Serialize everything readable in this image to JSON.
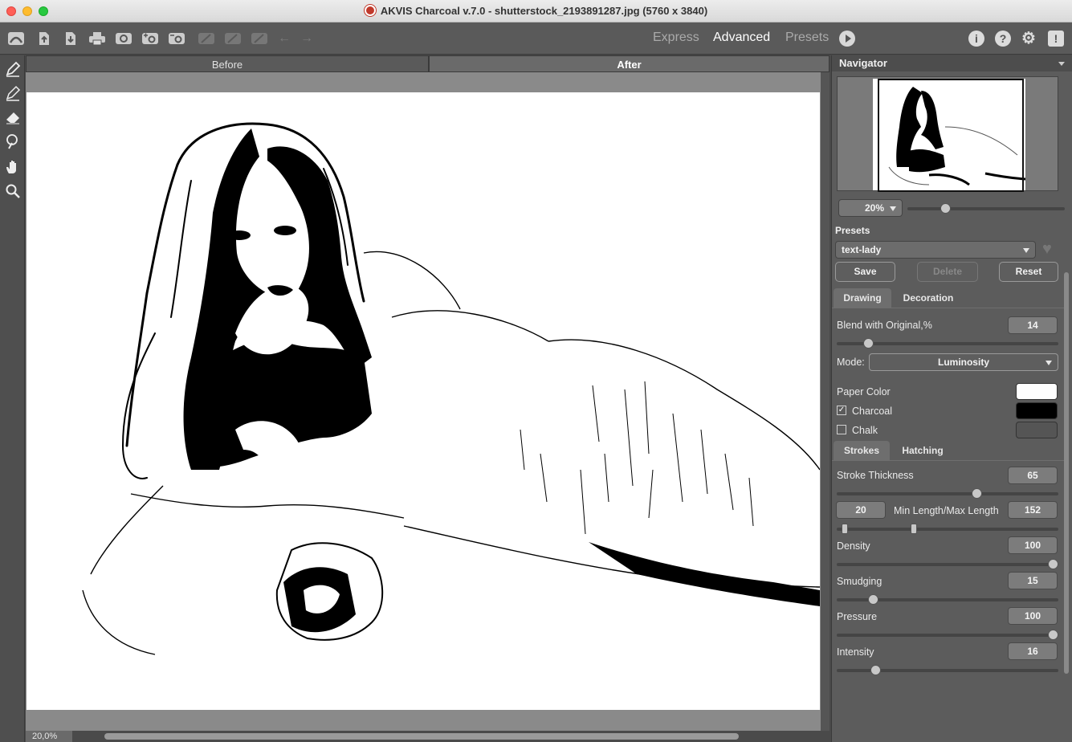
{
  "window": {
    "title": "AKVIS Charcoal v.7.0 - shutterstock_2193891287.jpg (5760 x 3840)"
  },
  "toolbar": {
    "icons": [
      "home-icon",
      "open-icon",
      "save-icon",
      "print-icon",
      "batch-icon",
      "plugin-import-icon",
      "plugin-export-icon",
      "brush-stroke-icon",
      "brush-settings-icon",
      "brush-edit-icon",
      "undo-icon",
      "redo-icon"
    ],
    "modes": {
      "express": "Express",
      "advanced": "Advanced",
      "presets": "Presets"
    },
    "active_mode": "Advanced",
    "right_icons": {
      "info": "i",
      "help": "?",
      "settings": "⚙",
      "notify": "!"
    }
  },
  "view_tabs": {
    "before": "Before",
    "after": "After",
    "active": "After"
  },
  "status": {
    "zoom": "20,0%"
  },
  "navigator": {
    "title": "Navigator",
    "zoom": "20%",
    "zoom_slider_fraction": 0.24
  },
  "presets": {
    "label": "Presets",
    "selected": "text-lady",
    "save": "Save",
    "delete": "Delete",
    "reset": "Reset"
  },
  "tabs": {
    "drawing": "Drawing",
    "decoration": "Decoration",
    "strokes": "Strokes",
    "hatching": "Hatching"
  },
  "drawing": {
    "blend_label": "Blend with Original,%",
    "blend_value": "14",
    "blend_fraction": 0.14,
    "mode_label": "Mode:",
    "mode_value": "Luminosity",
    "paper_color_label": "Paper Color",
    "paper_color": "#ffffff",
    "charcoal_label": "Charcoal",
    "charcoal_checked": true,
    "charcoal_color": "#000000",
    "chalk_label": "Chalk",
    "chalk_checked": false,
    "chalk_color": "#555555"
  },
  "strokes": {
    "thickness_label": "Stroke Thickness",
    "thickness_value": "65",
    "thickness_fraction": 0.63,
    "min_length_value": "20",
    "minmax_label": "Min Length/Max Length",
    "max_length_value": "152",
    "density_label": "Density",
    "density_value": "100",
    "smudging_label": "Smudging",
    "smudging_value": "15",
    "pressure_label": "Pressure",
    "pressure_value": "100",
    "intensity_label": "Intensity",
    "intensity_value": "16"
  }
}
